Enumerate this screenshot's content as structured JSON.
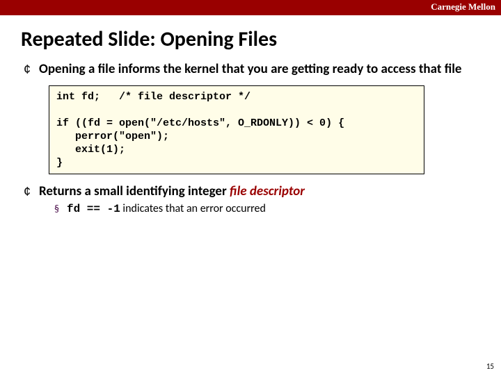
{
  "topbar": {
    "label": "Carnegie Mellon"
  },
  "title": "Repeated Slide:  Opening Files",
  "bullet1": "Opening a file informs the kernel that you are getting ready to access that file",
  "code": "int fd;   /* file descriptor */\n\nif ((fd = open(\"/etc/hosts\", O_RDONLY)) < 0) {\n   perror(\"open\");\n   exit(1);\n}",
  "bullet2_prefix": "Returns a small identifying integer ",
  "bullet2_emph": "file descriptor",
  "subbullet_code": "fd == -1",
  "subbullet_rest": " indicates that an error occurred",
  "page_number": "15"
}
